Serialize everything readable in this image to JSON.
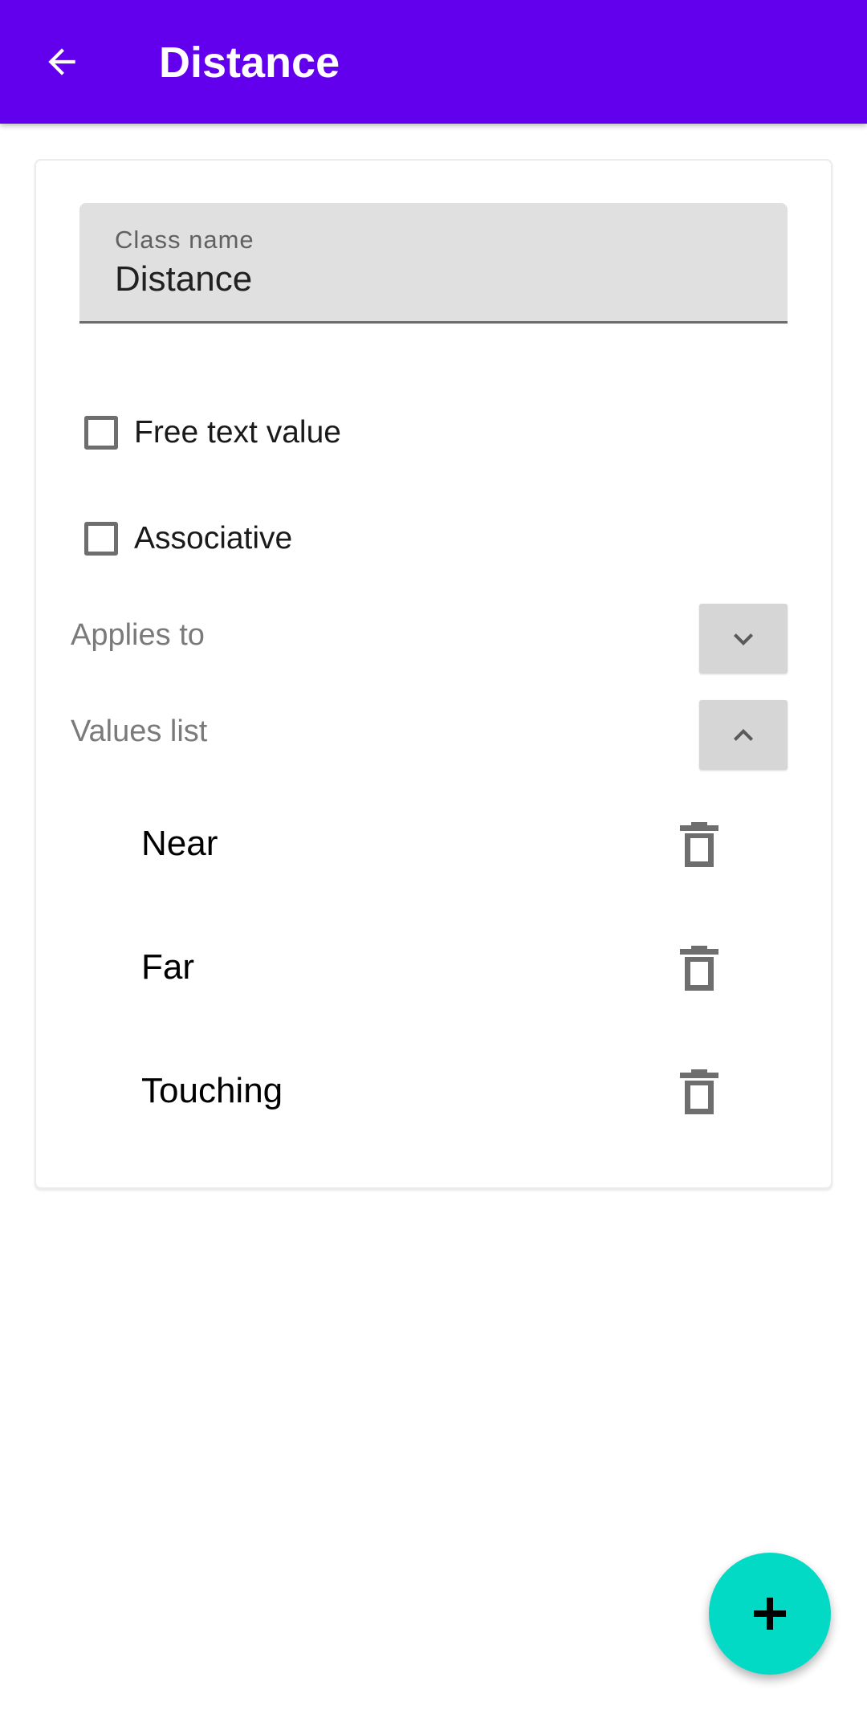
{
  "appbar": {
    "title": "Distance",
    "back_icon": "arrow-back-icon",
    "color": "#6200ee"
  },
  "form": {
    "class_name_label": "Class name",
    "class_name_value": "Distance",
    "free_text_label": "Free text value",
    "free_text_checked": false,
    "associative_label": "Associative",
    "associative_checked": false,
    "applies_to_label": "Applies to",
    "applies_to_icon": "chevron-down-icon",
    "values_list_label": "Values list",
    "values_list_icon": "chevron-up-icon"
  },
  "values": [
    {
      "label": "Near",
      "delete_icon": "delete-icon"
    },
    {
      "label": "Far",
      "delete_icon": "delete-icon"
    },
    {
      "label": "Touching",
      "delete_icon": "delete-icon"
    }
  ],
  "fab": {
    "icon": "add-icon",
    "color": "#03dac5"
  }
}
